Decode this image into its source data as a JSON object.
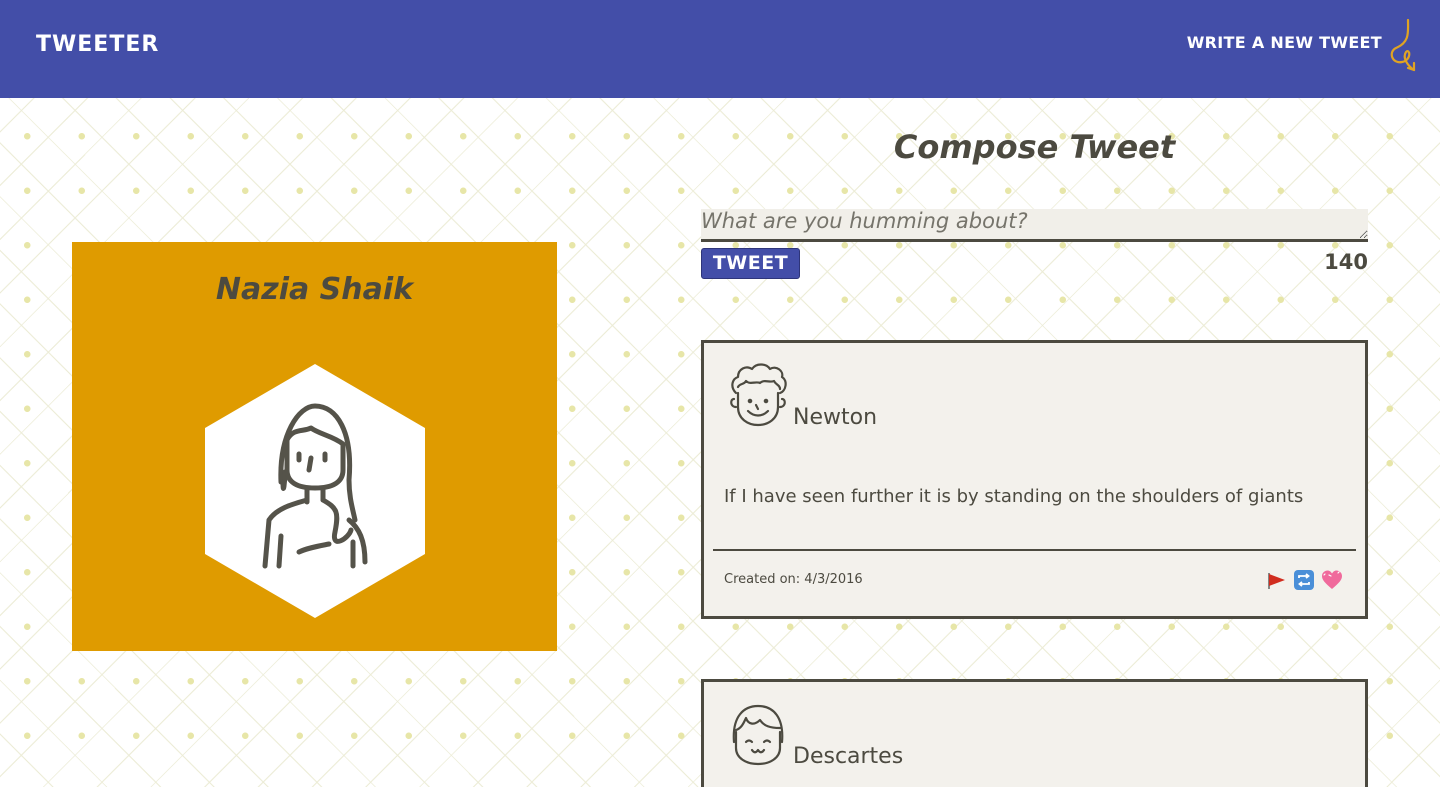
{
  "navbar": {
    "brand": "Tweeter",
    "compose_link": "Write a new tweet",
    "color": "#434ea8"
  },
  "profile": {
    "name": "Nazia Shaik",
    "card_color": "#df9b00"
  },
  "compose": {
    "title": "Compose Tweet",
    "placeholder": "What are you humming about?",
    "button_label": "Tweet",
    "counter": "140"
  },
  "tweets": [
    {
      "user": "Newton",
      "content": "If I have seen further it is by standing on the shoulders of giants",
      "date_prefix": "Created on:",
      "date": "4/3/2016",
      "actions": [
        "flag-icon",
        "retweet-icon",
        "heart-icon"
      ]
    },
    {
      "user": "Descartes"
    }
  ],
  "colors": {
    "text": "#4c4a40",
    "tweet_bg": "#f3f1ec"
  }
}
